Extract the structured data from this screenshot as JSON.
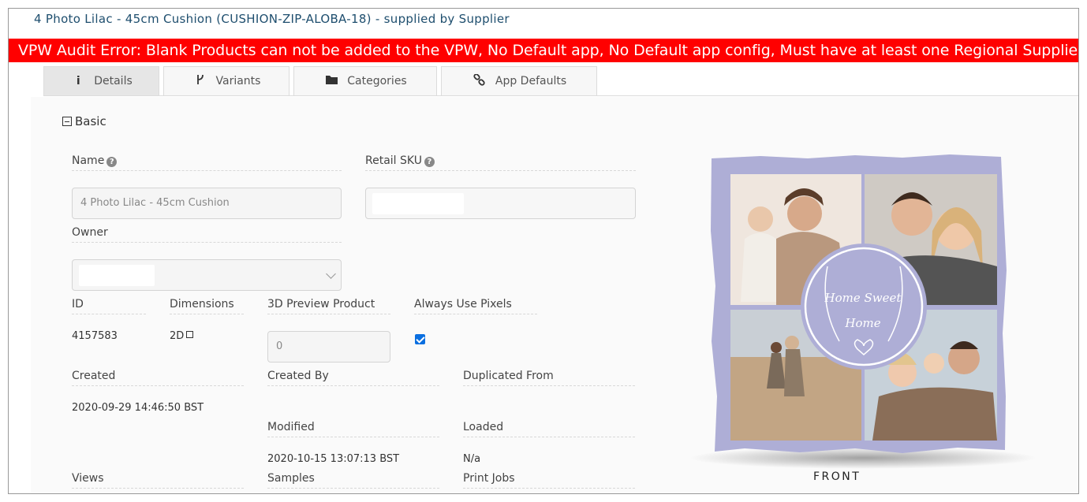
{
  "page": {
    "title": "4 Photo Lilac - 45cm Cushion (CUSHION-ZIP-ALOBA-18) - supplied by Supplier",
    "error": "VPW Audit Error: Blank Products can not be added to the VPW, No Default app, No Default app config, Must have at least one Regional Supplier",
    "error_color": "#ff0000"
  },
  "tabs": [
    {
      "label": "Details",
      "icon": "info-icon",
      "active": true
    },
    {
      "label": "Variants",
      "icon": "branch-icon",
      "active": false
    },
    {
      "label": "Categories",
      "icon": "folder-icon",
      "active": false
    },
    {
      "label": "App Defaults",
      "icon": "link-icon",
      "active": false
    }
  ],
  "section": {
    "label": "Basic"
  },
  "fields": {
    "name": {
      "label": "Name",
      "value": "4 Photo Lilac - 45cm Cushion"
    },
    "retail_sku": {
      "label": "Retail SKU"
    },
    "owner": {
      "label": "Owner"
    },
    "id": {
      "label": "ID",
      "value": "4157583"
    },
    "dimensions": {
      "label": "Dimensions",
      "value": "2D"
    },
    "preview3d": {
      "label": "3D Preview Product",
      "value": "0"
    },
    "always_pixels": {
      "label": "Always Use Pixels",
      "checked": true
    },
    "created": {
      "label": "Created",
      "value": "2020-09-29 14:46:50 BST"
    },
    "created_by": {
      "label": "Created By"
    },
    "duplicated_from": {
      "label": "Duplicated From"
    },
    "modified": {
      "label": "Modified",
      "value": "2020-10-15 13:07:13 BST"
    },
    "loaded": {
      "label": "Loaded",
      "value": "N/a"
    },
    "views": {
      "label": "Views"
    },
    "samples": {
      "label": "Samples"
    },
    "print_jobs": {
      "label": "Print Jobs"
    }
  },
  "preview": {
    "cushion_color": "#aeaed6",
    "badge_text_1": "Home Sweet",
    "badge_text_2": "Home",
    "caption": "FRONT"
  }
}
